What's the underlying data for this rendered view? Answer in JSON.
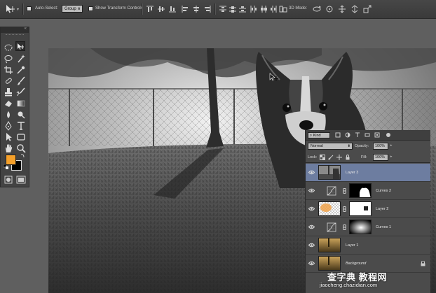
{
  "options_bar": {
    "auto_select_label": "Auto-Select:",
    "auto_select_value": "Group",
    "show_transform_label": "Show Transform Controls",
    "threed_mode_label": "3D Mode:"
  },
  "tools_panel": {
    "foreground_color": "#f5a02a",
    "background_color": "#000000",
    "tools": [
      "marquee",
      "move",
      "lasso",
      "magic-wand",
      "crop",
      "eyedropper",
      "healing-brush",
      "brush",
      "clone-stamp",
      "history-brush",
      "eraser",
      "gradient",
      "blur",
      "dodge",
      "pen",
      "type",
      "path-selection",
      "shape",
      "hand",
      "zoom"
    ]
  },
  "layers_panel": {
    "kind_filter": "Kind",
    "blend_mode": "Normal",
    "opacity_label": "Opacity:",
    "opacity_value": "100%",
    "lock_label": "Lock:",
    "fill_label": "Fill:",
    "fill_value": "100%",
    "layers": [
      {
        "name": "Layer 3",
        "selected": true
      },
      {
        "name": "Curves 2",
        "adjustment": true
      },
      {
        "name": "Layer 2"
      },
      {
        "name": "Curves 1",
        "adjustment": true
      },
      {
        "name": "Layer 1"
      },
      {
        "name": "Background",
        "locked": true
      }
    ]
  },
  "watermark": {
    "line1": "查字典 教程网",
    "line2": "jiaocheng.chazidian.com"
  }
}
